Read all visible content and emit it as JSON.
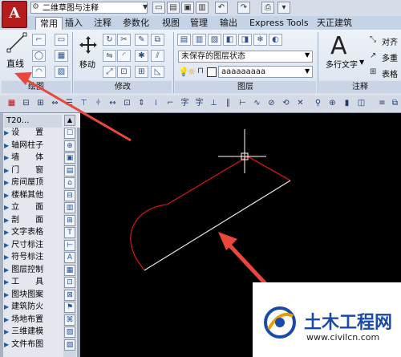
{
  "title_bar": {
    "workspace": "二维草图与注释"
  },
  "ribbon_tabs": [
    "常用",
    "插入",
    "注释",
    "参数化",
    "视图",
    "管理",
    "输出",
    "Express Tools",
    "天正建筑"
  ],
  "draw_panel": {
    "line_label": "直线",
    "panel_label": "绘图"
  },
  "modify_panel": {
    "move_label": "移动",
    "panel_label": "修改"
  },
  "layers_panel": {
    "layer_state": "未保存的图层状态",
    "layer_name": "aaaaaaaaa",
    "panel_label": "图层"
  },
  "annotation_panel": {
    "mtext_label": "多行文字",
    "align_label": "对齐",
    "multileader_label": "多重",
    "table_label": "表格",
    "panel_label": "注释"
  },
  "palette": {
    "title": "T20...",
    "items": [
      "设　　置",
      "轴网柱子",
      "墙　　体",
      "门　　窗",
      "房间屋顶",
      "楼梯其他",
      "立　　面",
      "剖　　面",
      "文字表格",
      "尺寸标注",
      "符号标注",
      "图层控制",
      "工　　具",
      "图块图案",
      "建筑防火",
      "场地布置",
      "三维建模",
      "文件布图"
    ]
  },
  "watermark": {
    "title": "土木工程网",
    "url": "www.civilcn.com"
  },
  "colors": {
    "drawing_red": "#d01515",
    "drawing_white": "#e8e8e8",
    "annotation_arrow": "#e8473a",
    "app_red": "#b71c1c",
    "watermark_blue": "#1a4aa8"
  }
}
